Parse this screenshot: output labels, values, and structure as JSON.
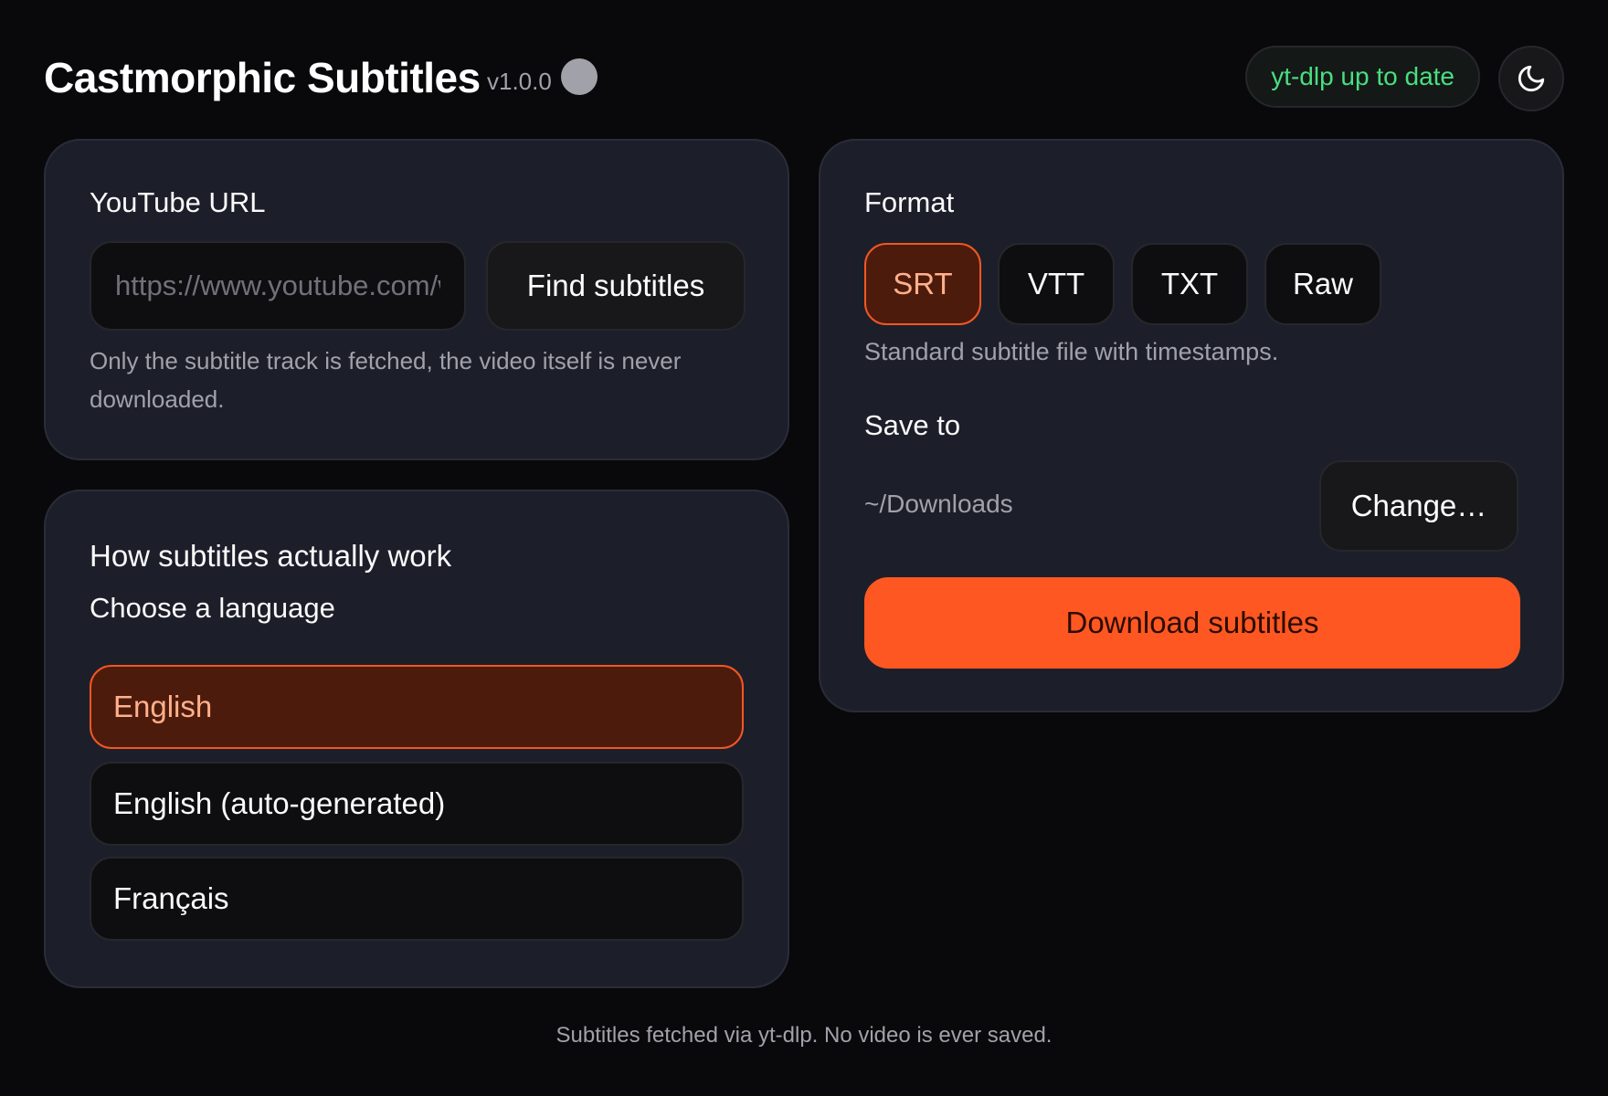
{
  "header": {
    "title": "Castmorphic Subtitles",
    "version": "v1.0.0",
    "update_status": "yt-dlp up to date"
  },
  "url_card": {
    "label": "YouTube URL",
    "input_placeholder": "https://www.youtube.com/watch?v=...",
    "input_value": "",
    "find_button": "Find subtitles",
    "hint": "Only the subtitle track is fetched, the video itself is never downloaded."
  },
  "language_card": {
    "heading": "How subtitles actually work",
    "subheading": "Choose a language",
    "options": [
      {
        "label": "English",
        "selected": true
      },
      {
        "label": "English (auto-generated)",
        "selected": false
      },
      {
        "label": "Français",
        "selected": false
      }
    ]
  },
  "format_card": {
    "label": "Format",
    "formats": [
      {
        "label": "SRT",
        "selected": true
      },
      {
        "label": "VTT",
        "selected": false
      },
      {
        "label": "TXT",
        "selected": false
      },
      {
        "label": "Raw",
        "selected": false
      }
    ],
    "description": "Standard subtitle file with timestamps.",
    "save_label": "Save to",
    "save_path": "~/Downloads",
    "change_button": "Change…",
    "download_button": "Download subtitles"
  },
  "footer": "Subtitles fetched via yt-dlp. No video is ever saved.",
  "icons": {
    "theme": "moon-icon",
    "status": "status-dot-icon"
  },
  "colors": {
    "accent": "#ff5722",
    "selected_bg": "#4d1b0c",
    "success": "#4ade80"
  }
}
